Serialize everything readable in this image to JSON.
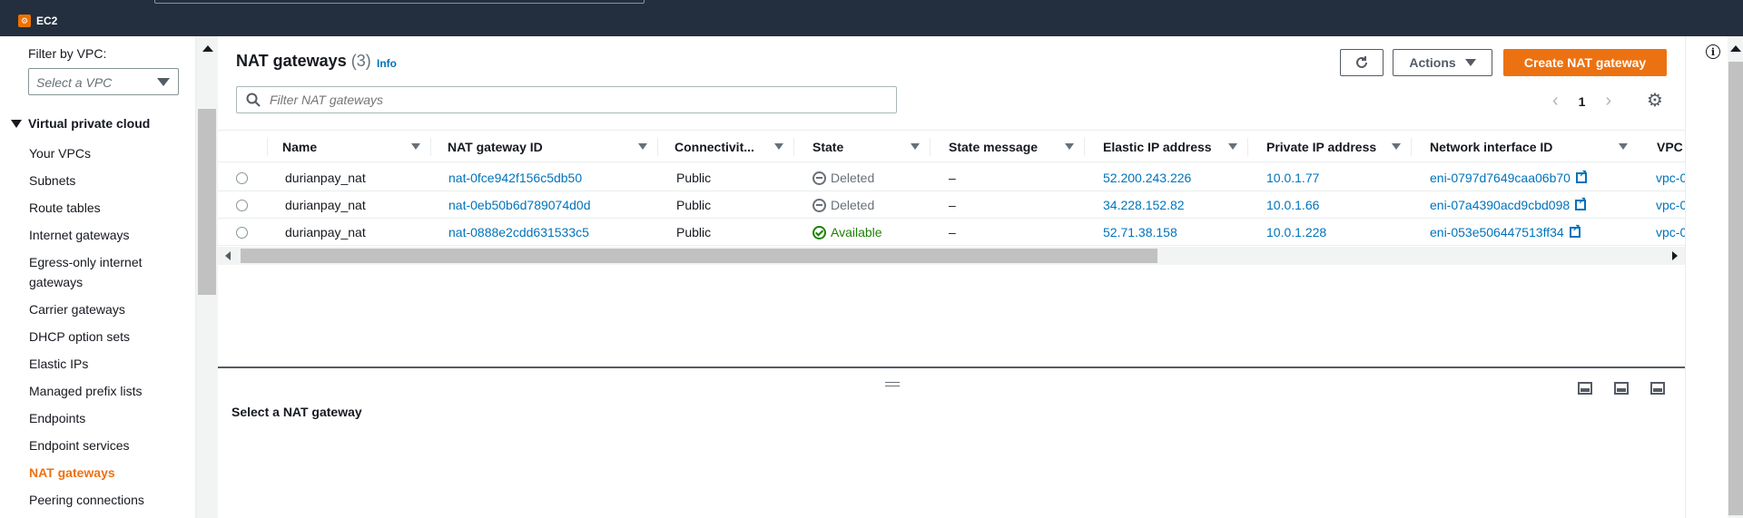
{
  "topbar": {
    "service_name": "EC2",
    "service_icon": "ec2-logo-icon"
  },
  "sidebar": {
    "filter_label": "Filter by VPC:",
    "vpc_select_placeholder": "Select a VPC",
    "section_title": "Virtual private cloud",
    "items": [
      {
        "label": "Your VPCs",
        "active": false
      },
      {
        "label": "Subnets",
        "active": false
      },
      {
        "label": "Route tables",
        "active": false
      },
      {
        "label": "Internet gateways",
        "active": false
      },
      {
        "label": "Egress-only internet gateways",
        "active": false
      },
      {
        "label": "Carrier gateways",
        "active": false
      },
      {
        "label": "DHCP option sets",
        "active": false
      },
      {
        "label": "Elastic IPs",
        "active": false
      },
      {
        "label": "Managed prefix lists",
        "active": false
      },
      {
        "label": "Endpoints",
        "active": false
      },
      {
        "label": "Endpoint services",
        "active": false
      },
      {
        "label": "NAT gateways",
        "active": true
      },
      {
        "label": "Peering connections",
        "active": false
      }
    ]
  },
  "main": {
    "title": "NAT gateways",
    "count": "(3)",
    "info_label": "Info",
    "actions_label": "Actions",
    "create_label": "Create NAT gateway",
    "filter_placeholder": "Filter NAT gateways",
    "page_number": "1",
    "columns": [
      "Name",
      "NAT gateway ID",
      "Connectivit...",
      "State",
      "State message",
      "Elastic IP address",
      "Private IP address",
      "Network interface ID",
      "VPC"
    ],
    "rows": [
      {
        "name": "durianpay_nat",
        "id": "nat-0fce942f156c5db50",
        "connectivity": "Public",
        "state": "Deleted",
        "state_message": "–",
        "elastic_ip": "52.200.243.226",
        "private_ip": "10.0.1.77",
        "eni": "eni-0797d7649caa06b70",
        "vpc": "vpc-0"
      },
      {
        "name": "durianpay_nat",
        "id": "nat-0eb50b6d789074d0d",
        "connectivity": "Public",
        "state": "Deleted",
        "state_message": "–",
        "elastic_ip": "34.228.152.82",
        "private_ip": "10.0.1.66",
        "eni": "eni-07a4390acd9cbd098",
        "vpc": "vpc-0"
      },
      {
        "name": "durianpay_nat",
        "id": "nat-0888e2cdd631533c5",
        "connectivity": "Public",
        "state": "Available",
        "state_message": "–",
        "elastic_ip": "52.71.38.158",
        "private_ip": "10.0.1.228",
        "eni": "eni-053e506447513ff34",
        "vpc": "vpc-0"
      }
    ]
  },
  "split_panel": {
    "message": "Select a NAT gateway"
  },
  "colors": {
    "accent": "#ec7211",
    "link": "#0073bb",
    "topbar": "#232f3e",
    "success": "#1d8102",
    "muted": "#687078"
  }
}
